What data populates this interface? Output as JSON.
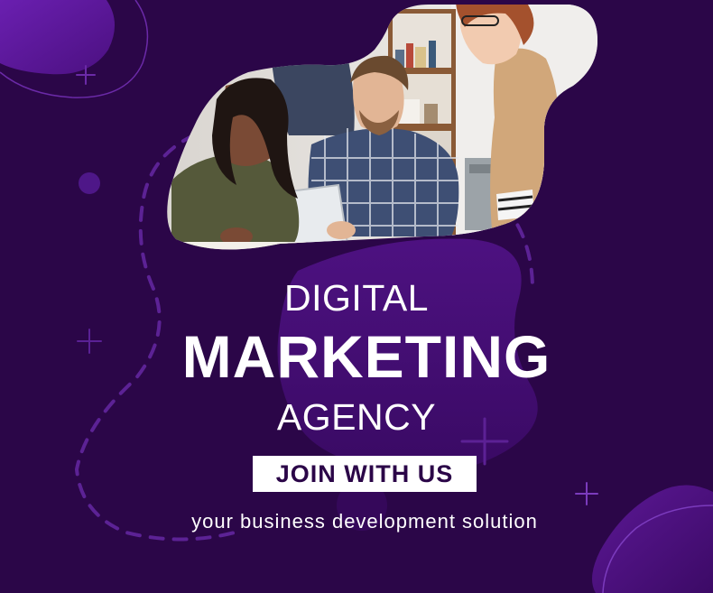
{
  "poster": {
    "line1": "DIGITAL",
    "line2": "MARKETING",
    "line3": "AGENCY",
    "cta_label": "JOIN WITH US",
    "tagline": "your business development solution"
  },
  "colors": {
    "background": "#2b0648",
    "blob": "#4a0f7a",
    "accent": "#7b3bbd",
    "text": "#ffffff"
  },
  "icons": [
    "plus-icon",
    "plus-icon",
    "plus-icon",
    "plus-icon"
  ]
}
